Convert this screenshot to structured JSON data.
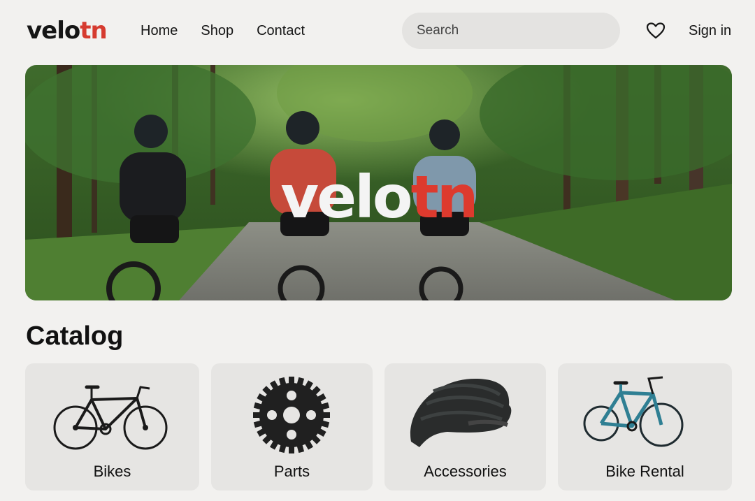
{
  "brand": {
    "part1": "velo",
    "part2": "tn"
  },
  "nav": {
    "items": [
      "Home",
      "Shop",
      "Contact"
    ]
  },
  "search": {
    "placeholder": "Search"
  },
  "header": {
    "wishlist_icon": "heart-icon",
    "signin_label": "Sign in"
  },
  "hero": {
    "brand_part1": "velo",
    "brand_part2": "tn"
  },
  "catalog": {
    "title": "Catalog",
    "items": [
      {
        "label": "Bikes",
        "icon": "road-bike-icon"
      },
      {
        "label": "Parts",
        "icon": "chainring-icon"
      },
      {
        "label": "Accessories",
        "icon": "helmet-icon"
      },
      {
        "label": "Bike Rental",
        "icon": "city-bike-icon"
      }
    ]
  },
  "colors": {
    "accent": "#d63b2f",
    "background": "#f2f1ef",
    "card": "#e6e5e3"
  }
}
